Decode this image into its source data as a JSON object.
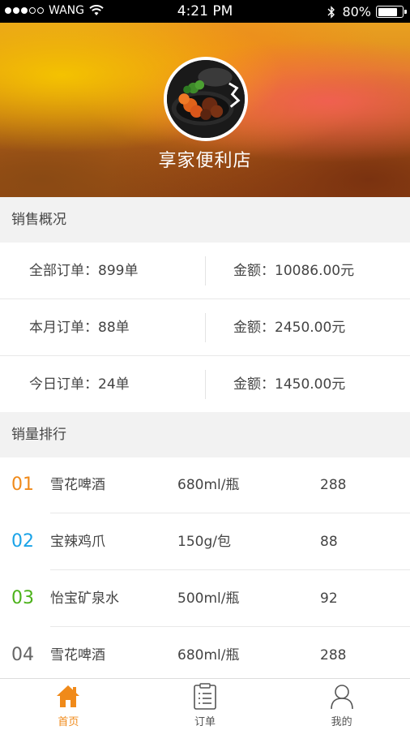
{
  "status_bar": {
    "carrier": "WANG",
    "time": "4:21 PM",
    "battery": "80%"
  },
  "header": {
    "store_name": "享家便利店"
  },
  "sales_overview": {
    "title": "销售概况",
    "rows": [
      {
        "orders": "全部订单：899单",
        "amount": "金额：10086.00元"
      },
      {
        "orders": "本月订单：88单",
        "amount": "金额：2450.00元"
      },
      {
        "orders": "今日订单：24单",
        "amount": "金额：1450.00元"
      }
    ]
  },
  "ranking": {
    "title": "销量排行",
    "items": [
      {
        "rank": "01",
        "name": "雪花啤酒",
        "spec": "680ml/瓶",
        "count": "288",
        "color": "#f08a1a"
      },
      {
        "rank": "02",
        "name": "宝辣鸡爪",
        "spec": "150g/包",
        "count": "88",
        "color": "#1aa3e8"
      },
      {
        "rank": "03",
        "name": "怡宝矿泉水",
        "spec": "500ml/瓶",
        "count": "92",
        "color": "#4cb21a"
      },
      {
        "rank": "04",
        "name": "雪花啤酒",
        "spec": "680ml/瓶",
        "count": "288",
        "color": "#666666"
      }
    ]
  },
  "tab_bar": {
    "tabs": [
      {
        "label": "首页",
        "icon": "home-icon",
        "active": true
      },
      {
        "label": "订单",
        "icon": "order-list-icon",
        "active": false
      },
      {
        "label": "我的",
        "icon": "person-icon",
        "active": false
      }
    ]
  },
  "colors": {
    "accent": "#f08a1a",
    "rank_1": "#f08a1a",
    "rank_2": "#1aa3e8",
    "rank_3": "#4cb21a",
    "rank_4": "#666666"
  }
}
